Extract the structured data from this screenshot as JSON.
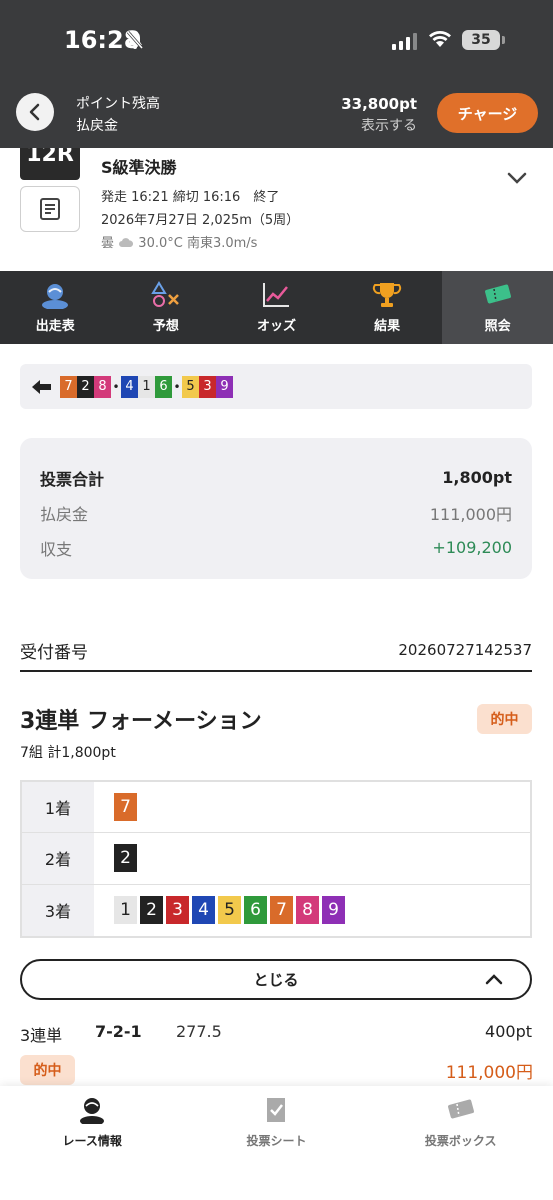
{
  "status": {
    "time": "16:28",
    "battery": "35"
  },
  "header": {
    "points_label": "ポイント残高",
    "refund_label": "払戻金",
    "points_value": "33,800pt",
    "refund_value": "表示する",
    "charge_label": "チャージ"
  },
  "race": {
    "badge": "12R",
    "title": "S級準決勝",
    "line1": "発走 16:21 締切 16:16　終了",
    "line2": "2026年7月27日 2,025m（5周）",
    "weather": "曇",
    "line3": "30.0°C 南東3.0m/s"
  },
  "tabs": [
    {
      "label": "出走表"
    },
    {
      "label": "予想"
    },
    {
      "label": "オッズ"
    },
    {
      "label": "結果"
    },
    {
      "label": "照会"
    }
  ],
  "strip": {
    "groups": [
      [
        "7",
        "2",
        "8"
      ],
      [
        "4",
        "1",
        "6"
      ],
      [
        "5",
        "3",
        "9"
      ]
    ],
    "separator": "•"
  },
  "colors": {
    "1": "#e6e6e6",
    "2": "#222222",
    "3": "#c8282b",
    "4": "#1f47b4",
    "5": "#f2c94c",
    "6": "#2f9a3b",
    "7": "#d96b2a",
    "8": "#d33a7a",
    "9": "#8e2fb5"
  },
  "summary": {
    "rows": [
      {
        "label": "投票合計",
        "value": "1,800pt"
      },
      {
        "label": "払戻金",
        "value": "111,000円"
      },
      {
        "label": "収支",
        "value": "+109,200"
      }
    ]
  },
  "ticket": {
    "label": "受付番号",
    "number": "20260727142537",
    "bet_type": "3連単 フォーメーション",
    "hit_label": "的中",
    "sub": "7組 計1,800pt",
    "rows": [
      {
        "head": "1着",
        "cells": [
          "7"
        ]
      },
      {
        "head": "2着",
        "cells": [
          "2"
        ]
      },
      {
        "head": "3着",
        "cells": [
          "1",
          "2",
          "3",
          "4",
          "5",
          "6",
          "7",
          "8",
          "9"
        ]
      }
    ],
    "close_label": "とじる"
  },
  "result": {
    "type": "3連単",
    "combo": "7-2-1",
    "odds": "277.5",
    "stake": "400pt",
    "hit_label": "的中",
    "payout": "111,000円"
  },
  "bottom_nav": [
    {
      "label": "レース情報"
    },
    {
      "label": "投票シート"
    },
    {
      "label": "投票ボックス"
    }
  ]
}
